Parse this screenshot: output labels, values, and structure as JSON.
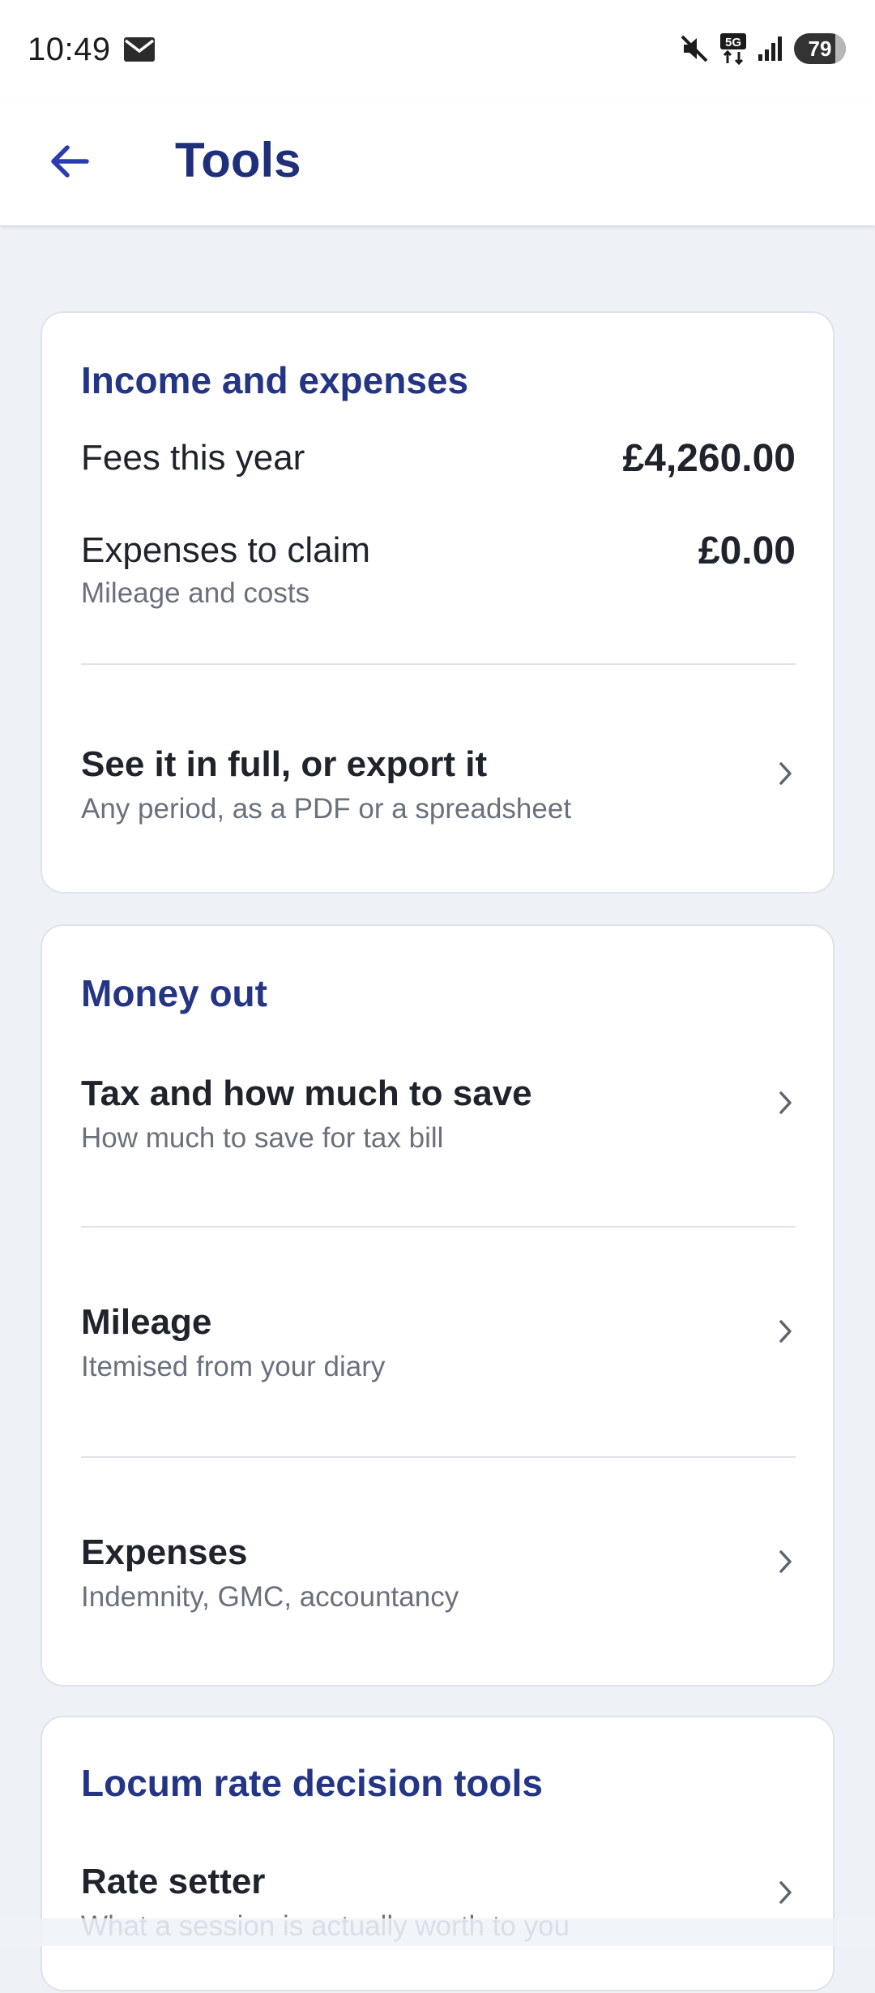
{
  "status_bar": {
    "time": "10:49",
    "battery": "79",
    "battery_level": 0.79,
    "icons": [
      "mail-icon",
      "mute-icon",
      "5g-icon",
      "signal-icon"
    ]
  },
  "app_bar": {
    "title": "Tools",
    "back_icon": "arrow-left-icon"
  },
  "colors": {
    "accent": "#2a3bb5",
    "title": "#1f2f7a",
    "section_title": "#243585",
    "background": "#eef2f7"
  },
  "income": {
    "title": "Income and expenses",
    "fees_label": "Fees this year",
    "fees_value": "£4,260.00",
    "expenses_label": "Expenses to claim",
    "expenses_sub": "Mileage and costs",
    "expenses_value": "£0.00",
    "export_title": "See it in full, or export it",
    "export_sub": "Any period, as a PDF or a spreadsheet"
  },
  "money_out": {
    "title": "Money out",
    "items": [
      {
        "title": "Tax and how much to save",
        "sub": "How much to save for tax bill"
      },
      {
        "title": "Mileage",
        "sub": "Itemised from your diary"
      },
      {
        "title": "Expenses",
        "sub": "Indemnity, GMC, accountancy"
      }
    ]
  },
  "locum": {
    "title": "Locum rate decision tools",
    "items": [
      {
        "title": "Rate setter",
        "sub": "What a session is actually worth to you"
      }
    ]
  }
}
